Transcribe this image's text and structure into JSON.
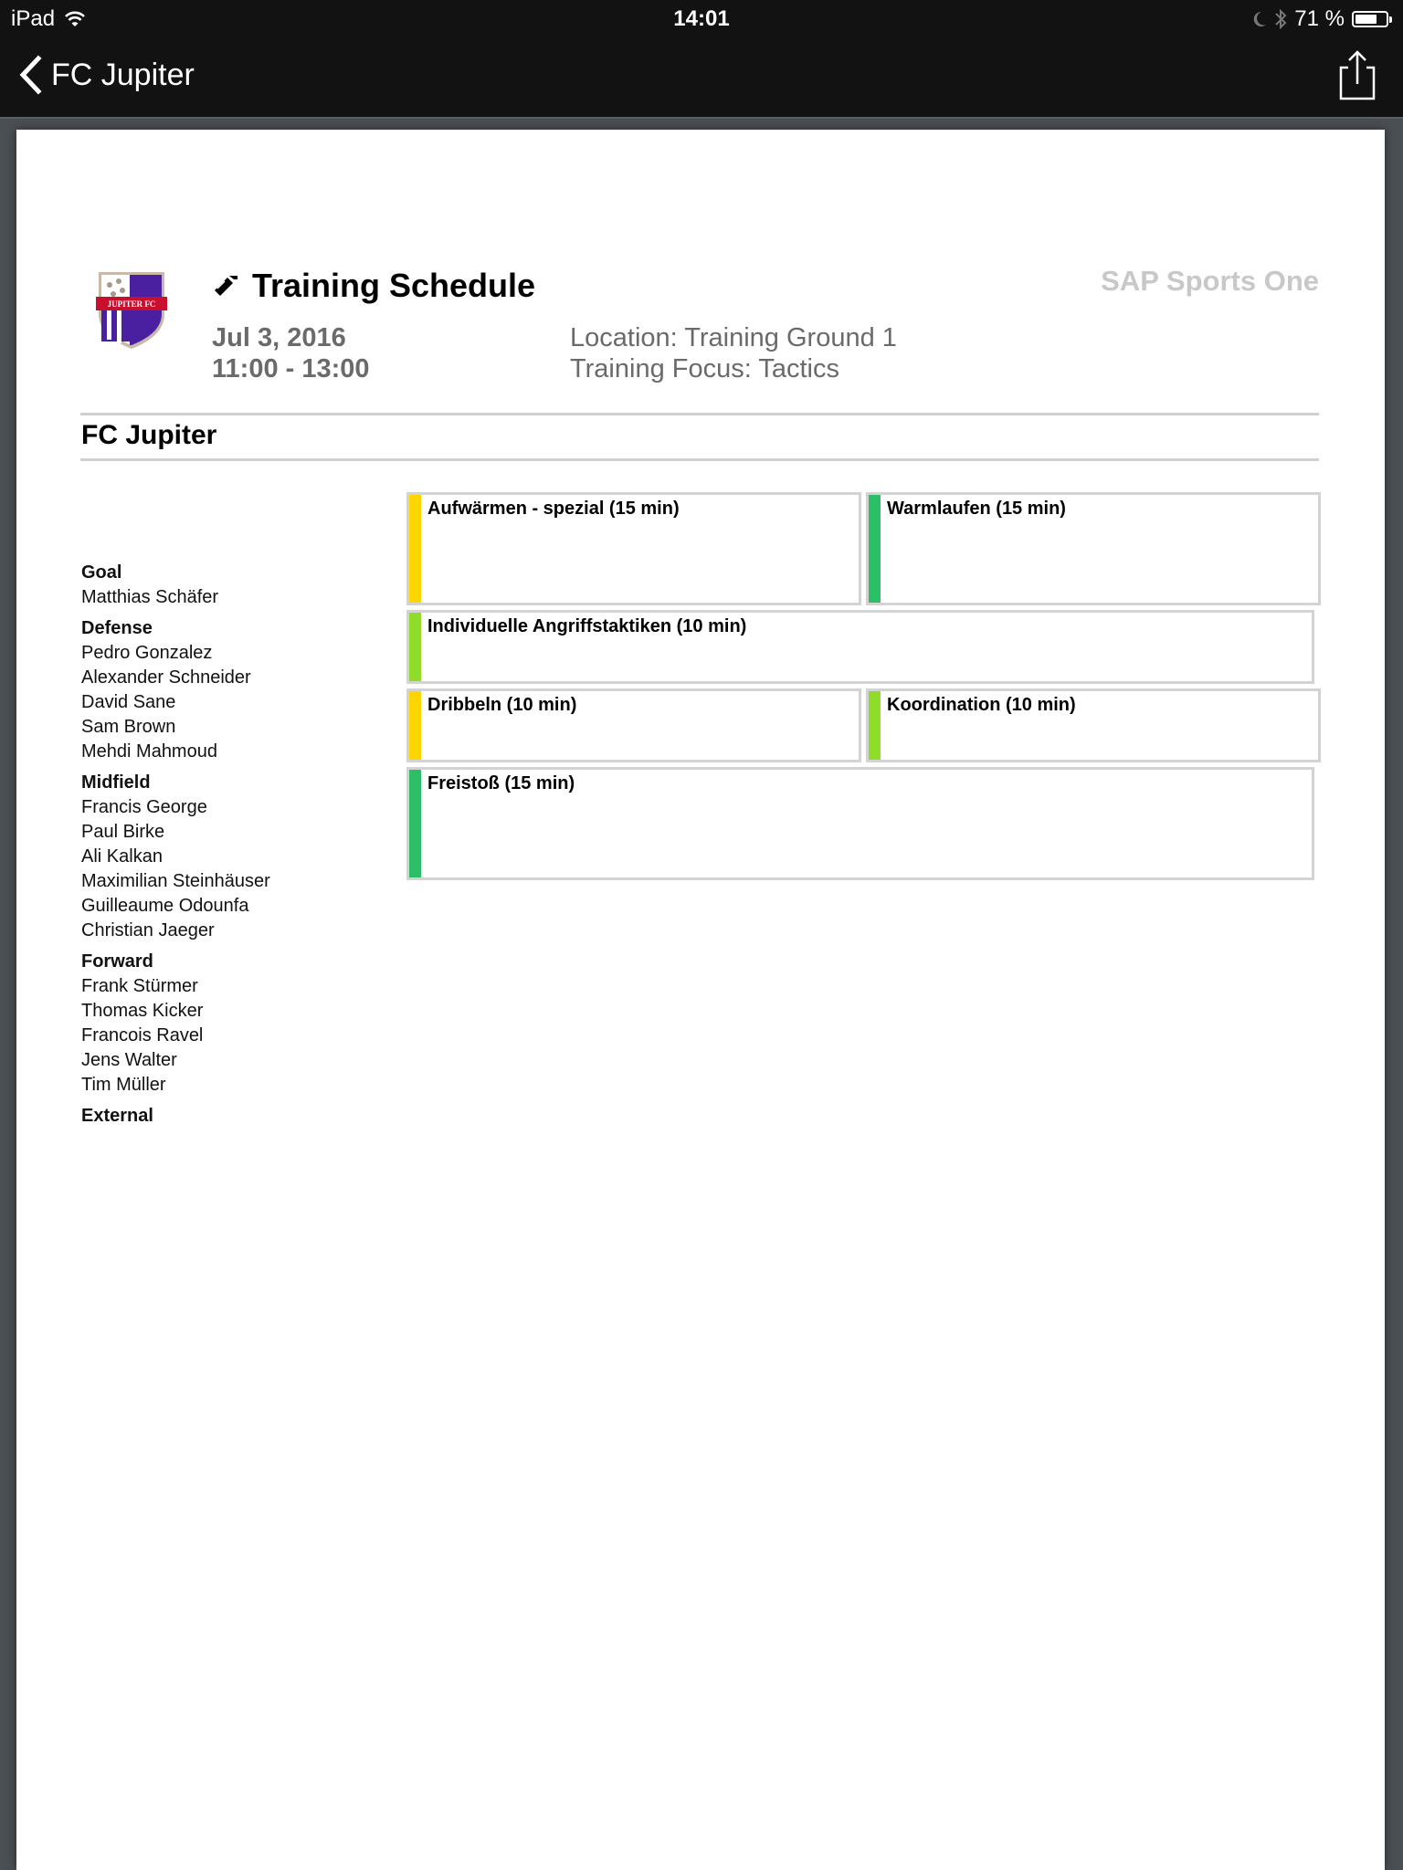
{
  "status_bar": {
    "device": "iPad",
    "time": "14:01",
    "battery_percent_label": "71 %",
    "battery_level": 0.71
  },
  "nav": {
    "back_label": "FC Jupiter"
  },
  "document": {
    "club_logo_text": "JUPITER FC",
    "title": "Training Schedule",
    "brand": "SAP Sports One",
    "date": "Jul 3, 2016",
    "time": "11:00 - 13:00",
    "location": "Location: Training Ground 1",
    "focus": "Training Focus: Tactics",
    "team_name": "FC Jupiter",
    "roster": [
      {
        "position": "Goal",
        "players": [
          "Matthias  Schäfer"
        ]
      },
      {
        "position": "Defense",
        "players": [
          "Pedro Gonzalez",
          "Alexander Schneider",
          "David Sane",
          "Sam Brown",
          "Mehdi Mahmoud"
        ]
      },
      {
        "position": "Midfield",
        "players": [
          "Francis George",
          "Paul Birke",
          "Ali Kalkan",
          "Maximilian Steinhäuser",
          "Guilleaume Odounfa",
          "Christian Jaeger"
        ]
      },
      {
        "position": "Forward",
        "players": [
          "Frank Stürmer",
          "Thomas Kicker",
          "Francois Ravel",
          "Jens Walter",
          "Tim Müller"
        ]
      },
      {
        "position": "External",
        "players": []
      }
    ],
    "drills": [
      {
        "label": "Aufwärmen - spezial (15 min)",
        "color": "#ffd500"
      },
      {
        "label": "Warmlaufen (15 min)",
        "color": "#2dbf68"
      },
      {
        "label": "Individuelle Angriffstaktiken (10 min)",
        "color": "#8fdc2a"
      },
      {
        "label": "Dribbeln (10 min)",
        "color": "#ffd500"
      },
      {
        "label": "Koordination (10 min)",
        "color": "#8fdc2a"
      },
      {
        "label": "Freistoß (15 min)",
        "color": "#2dbf68"
      }
    ]
  }
}
